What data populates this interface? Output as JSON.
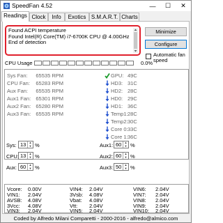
{
  "window": {
    "title": "SpeedFan 4.52"
  },
  "tabs": [
    "Readings",
    "Clock",
    "Info",
    "Exotics",
    "S.M.A.R.T.",
    "Charts"
  ],
  "log": [
    "Found ACPI temperature",
    "Found Intel(R) Core(TM) i7-6700K CPU @ 4.00GHz",
    "End of detection"
  ],
  "buttons": {
    "minimize": "Minimize",
    "configure": "Configure"
  },
  "auto_fan": "Automatic fan speed",
  "cpu_usage": {
    "label": "CPU Usage",
    "percent": "0.0%"
  },
  "fans": [
    {
      "name": "Sys Fan:",
      "value": "65535 RPM"
    },
    {
      "name": "CPU Fan:",
      "value": "65283 RPM"
    },
    {
      "name": "Aux Fan:",
      "value": "65535 RPM"
    },
    {
      "name": "Aux1 Fan:",
      "value": "65301 RPM"
    },
    {
      "name": "Aux2 Fan:",
      "value": "65280 RPM"
    },
    {
      "name": "Aux3 Fan:",
      "value": "65535 RPM"
    }
  ],
  "temps": [
    {
      "name": "GPU:",
      "value": "49C",
      "icon": "check"
    },
    {
      "name": "HD3:",
      "value": "31C",
      "icon": "down"
    },
    {
      "name": "HD2:",
      "value": "28C",
      "icon": "down"
    },
    {
      "name": "HD0:",
      "value": "29C",
      "icon": "down"
    },
    {
      "name": "HD1:",
      "value": "36C",
      "icon": "down"
    },
    {
      "name": "Temp1:",
      "value": "28C",
      "icon": "down"
    },
    {
      "name": "Temp2:",
      "value": "30C",
      "icon": "down"
    },
    {
      "name": "Core 0:",
      "value": "33C",
      "icon": "down"
    },
    {
      "name": "Core 1:",
      "value": "36C",
      "icon": "down"
    }
  ],
  "speeds_left": [
    {
      "name": "Sys:",
      "value": "13",
      "unit": "%"
    },
    {
      "name": "CPU:",
      "value": "13",
      "unit": "%"
    },
    {
      "name": "Aux:",
      "value": "60",
      "unit": "%"
    }
  ],
  "speeds_right": [
    {
      "name": "Aux1:",
      "value": "60",
      "unit": "%"
    },
    {
      "name": "Aux2:",
      "value": "60",
      "unit": "%"
    },
    {
      "name": "Aux3:",
      "value": "50",
      "unit": "%"
    }
  ],
  "voltages": [
    [
      {
        "name": "Vcore:",
        "value": "0.00V"
      },
      {
        "name": "VIN4:",
        "value": "2.04V"
      },
      {
        "name": "VIN6:",
        "value": "2.04V"
      }
    ],
    [
      {
        "name": "VIN1:",
        "value": "2.04V"
      },
      {
        "name": "3Vsb:",
        "value": "4.08V"
      },
      {
        "name": "VIN7:",
        "value": "2.04V"
      }
    ],
    [
      {
        "name": "AVSB:",
        "value": "4.08V"
      },
      {
        "name": "Vbat:",
        "value": "4.08V"
      },
      {
        "name": "VIN8:",
        "value": "2.04V"
      }
    ],
    [
      {
        "name": "3Vcc:",
        "value": "4.08V"
      },
      {
        "name": "Vtt:",
        "value": "2.04V"
      },
      {
        "name": "VIN9:",
        "value": "2.04V"
      }
    ],
    [
      {
        "name": "VIN3:",
        "value": "2.04V"
      },
      {
        "name": "VIN5:",
        "value": "2.04V"
      },
      {
        "name": "VIN10:",
        "value": "2.04V"
      }
    ]
  ],
  "footer": "Coded by Alfredo Milani Comparetti - 2000-2016 - alfredo@almico.com",
  "colors": {
    "highlight": "#e0202c",
    "check_green": "#1a9a2a",
    "arrow_blue": "#1e4fcf"
  }
}
